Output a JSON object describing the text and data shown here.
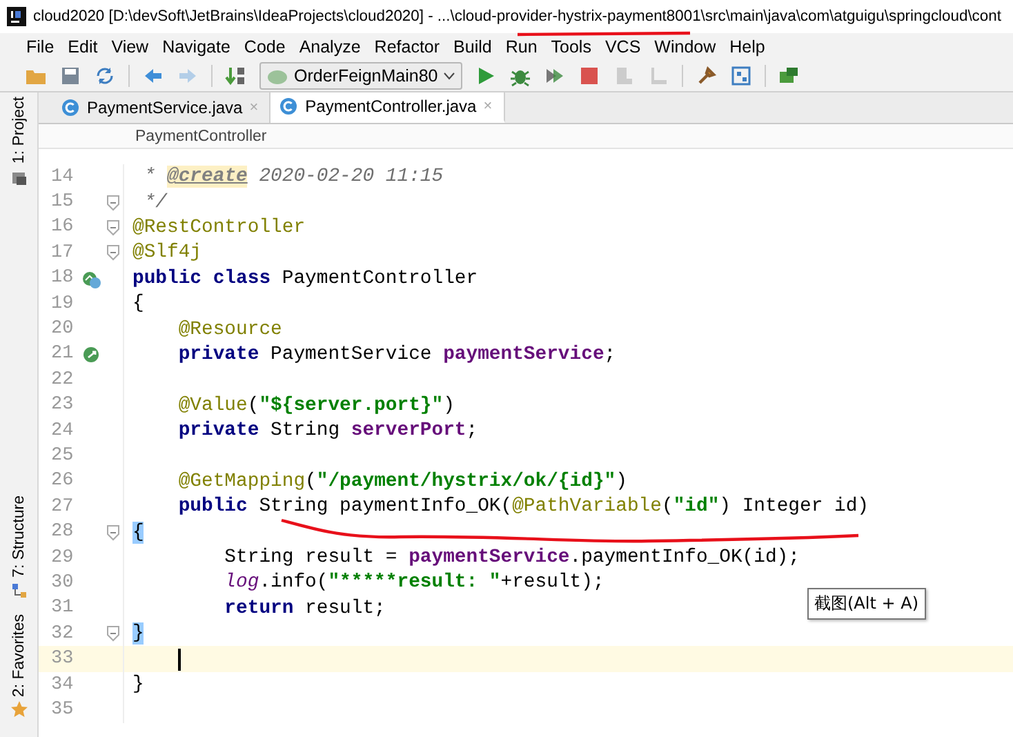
{
  "window": {
    "title": "cloud2020 [D:\\devSoft\\JetBrains\\IdeaProjects\\cloud2020] - ...\\cloud-provider-hystrix-payment8001\\src\\main\\java\\com\\atguigu\\springcloud\\cont"
  },
  "menu": [
    "File",
    "Edit",
    "View",
    "Navigate",
    "Code",
    "Analyze",
    "Refactor",
    "Build",
    "Run",
    "Tools",
    "VCS",
    "Window",
    "Help"
  ],
  "toolbar": {
    "buttons": [
      {
        "disabled": false
      },
      {
        "disabled": false
      },
      {
        "disabled": false
      },
      {
        "disabled": false
      },
      {
        "disabled": true
      },
      {
        "disabled": false
      },
      {
        "disabled": false
      },
      {
        "disabled": false
      },
      {
        "disabled": false
      },
      {
        "disabled": false
      },
      {
        "disabled": true
      },
      {
        "disabled": true
      },
      {
        "disabled": false
      },
      {
        "disabled": false
      },
      {
        "disabled": false
      }
    ],
    "run_configuration": "OrderFeignMain80"
  },
  "side_tabs": [
    {
      "label": "1: Project"
    },
    {
      "label": "7: Structure"
    },
    {
      "label": "2: Favorites"
    }
  ],
  "tabs": [
    {
      "label": "PaymentService.java",
      "close": "×",
      "selected": false
    },
    {
      "label": "PaymentController.java",
      "close": "×",
      "selected": true
    }
  ],
  "breadcrumb": "PaymentController",
  "lines": [
    {
      "number": "14",
      "tokens": [
        {
          "kind": "comment",
          "text": " * "
        },
        {
          "kind": "doctag",
          "text": "@create"
        },
        {
          "kind": "comment",
          "text": " 2020-02-20 11:15"
        }
      ]
    },
    {
      "number": "15",
      "fold": true,
      "tokens": [
        {
          "kind": "comment",
          "text": " */"
        }
      ]
    },
    {
      "number": "16",
      "fold": true,
      "tokens": [
        {
          "kind": "annotation",
          "text": "@RestController"
        }
      ]
    },
    {
      "number": "17",
      "fold": true,
      "tokens": [
        {
          "kind": "annotation",
          "text": "@Slf4j"
        }
      ]
    },
    {
      "number": "18",
      "gutter": {
        "kind": "bean"
      },
      "tokens": [
        {
          "kind": "keyword",
          "text": "public class"
        },
        {
          "kind": "plain",
          "text": " PaymentController"
        }
      ]
    },
    {
      "number": "19",
      "tokens": [
        {
          "kind": "plain",
          "text": "{"
        }
      ]
    },
    {
      "number": "20",
      "tokens": [
        {
          "kind": "annotation",
          "text": "    @Resource"
        }
      ]
    },
    {
      "number": "21",
      "gutter": {
        "kind": "inject"
      },
      "tokens": [
        {
          "kind": "keyword",
          "text": "    private"
        },
        {
          "kind": "plain",
          "text": " PaymentService "
        },
        {
          "kind": "field",
          "text": "paymentService"
        },
        {
          "kind": "plain",
          "text": ";"
        }
      ]
    },
    {
      "number": "22"
    },
    {
      "number": "23",
      "tokens": [
        {
          "kind": "annotation",
          "text": "    @Value"
        },
        {
          "kind": "plain",
          "text": "("
        },
        {
          "kind": "string",
          "text": "\"${server.port}\""
        },
        {
          "kind": "plain",
          "text": ")"
        }
      ]
    },
    {
      "number": "24",
      "tokens": [
        {
          "kind": "keyword",
          "text": "    private"
        },
        {
          "kind": "plain",
          "text": " String "
        },
        {
          "kind": "field",
          "text": "serverPort"
        },
        {
          "kind": "plain",
          "text": ";"
        }
      ]
    },
    {
      "number": "25"
    },
    {
      "number": "26",
      "tokens": [
        {
          "kind": "annotation",
          "text": "    @GetMapping"
        },
        {
          "kind": "plain",
          "text": "("
        },
        {
          "kind": "string",
          "text": "\"/payment/hystrix/ok/{id}\""
        },
        {
          "kind": "plain",
          "text": ")"
        }
      ]
    },
    {
      "number": "27",
      "tokens": [
        {
          "kind": "keyword",
          "text": "    public"
        },
        {
          "kind": "plain",
          "text": " String paymentInfo_OK("
        },
        {
          "kind": "annotation",
          "text": "@PathVariable"
        },
        {
          "kind": "plain",
          "text": "("
        },
        {
          "kind": "string",
          "text": "\"id\""
        },
        {
          "kind": "plain",
          "text": ") Integer id)"
        }
      ]
    },
    {
      "number": "28",
      "fold": true,
      "tokens": [
        {
          "kind": "brace",
          "text": "{"
        }
      ]
    },
    {
      "number": "29",
      "tokens": [
        {
          "kind": "plain",
          "text": "        String result = "
        },
        {
          "kind": "field",
          "text": "paymentService"
        },
        {
          "kind": "plain",
          "text": ".paymentInfo_OK(id);"
        }
      ]
    },
    {
      "number": "30",
      "tokens": [
        {
          "kind": "static",
          "text": "        log"
        },
        {
          "kind": "plain",
          "text": ".info("
        },
        {
          "kind": "string",
          "text": "\"*****result: \""
        },
        {
          "kind": "plain",
          "text": "+result);"
        }
      ]
    },
    {
      "number": "31",
      "tokens": [
        {
          "kind": "keyword",
          "text": "        return"
        },
        {
          "kind": "plain",
          "text": " result;"
        }
      ]
    },
    {
      "number": "32",
      "fold": true,
      "tokens": [
        {
          "kind": "brace",
          "text": "}"
        }
      ]
    },
    {
      "number": "33",
      "current": true
    },
    {
      "number": "34",
      "tokens": [
        {
          "kind": "plain",
          "text": "}"
        }
      ]
    },
    {
      "number": "35"
    }
  ],
  "tooltip": "截图(Alt + A)"
}
